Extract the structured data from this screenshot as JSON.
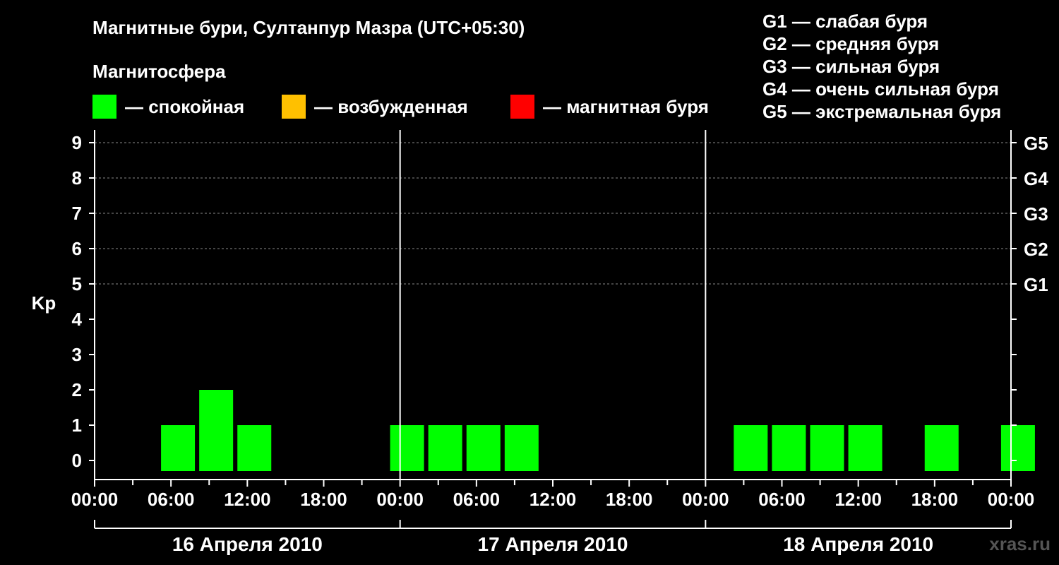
{
  "header": {
    "title": "Магнитные бури, Султанпур Мазра (UTC+05:30)",
    "subtitle": "Магнитосфера"
  },
  "legend": [
    {
      "label": "— спокойная",
      "color": "#00ff00"
    },
    {
      "label": "— возбужденная",
      "color": "#ffc000"
    },
    {
      "label": "— магнитная буря",
      "color": "#ff0000"
    }
  ],
  "g_levels": [
    "G1 — слабая буря",
    "G2 — средняя буря",
    "G3 — сильная буря",
    "G4 — очень сильная буря",
    "G5 — экстремальная буря"
  ],
  "watermark": "xras.ru",
  "chart_data": {
    "type": "bar",
    "ylabel": "Kp",
    "ylim": [
      0,
      9
    ],
    "y_ticks": [
      "0",
      "1",
      "2",
      "3",
      "4",
      "5",
      "6",
      "7",
      "8",
      "9"
    ],
    "right_axis_labels": [
      {
        "kp": 5,
        "label": "G1"
      },
      {
        "kp": 6,
        "label": "G2"
      },
      {
        "kp": 7,
        "label": "G3"
      },
      {
        "kp": 8,
        "label": "G4"
      },
      {
        "kp": 9,
        "label": "G5"
      }
    ],
    "grid_levels": [
      5,
      6,
      7,
      8,
      9
    ],
    "x_tick_labels": [
      "00:00",
      "06:00",
      "12:00",
      "18:00",
      "00:00",
      "06:00",
      "12:00",
      "18:00",
      "00:00",
      "06:00",
      "12:00",
      "18:00",
      "00:00"
    ],
    "days": [
      "16 Апреля 2010",
      "17 Апреля 2010",
      "18 Апреля 2010"
    ],
    "bar_color": "#00ff00",
    "categories": [
      "16.04 00:00",
      "16.04 03:00",
      "16.04 06:00",
      "16.04 09:00",
      "16.04 12:00",
      "16.04 15:00",
      "16.04 18:00",
      "16.04 21:00",
      "17.04 00:00",
      "17.04 03:00",
      "17.04 06:00",
      "17.04 09:00",
      "17.04 12:00",
      "17.04 15:00",
      "17.04 18:00",
      "17.04 21:00",
      "18.04 00:00",
      "18.04 03:00",
      "18.04 06:00",
      "18.04 09:00",
      "18.04 12:00",
      "18.04 15:00",
      "18.04 18:00",
      "18.04 21:00"
    ],
    "values": [
      0,
      1,
      2,
      1,
      0,
      0,
      0,
      1,
      1,
      1,
      1,
      0,
      0,
      0,
      0,
      0,
      1,
      1,
      1,
      1,
      0,
      1,
      0,
      1
    ]
  }
}
